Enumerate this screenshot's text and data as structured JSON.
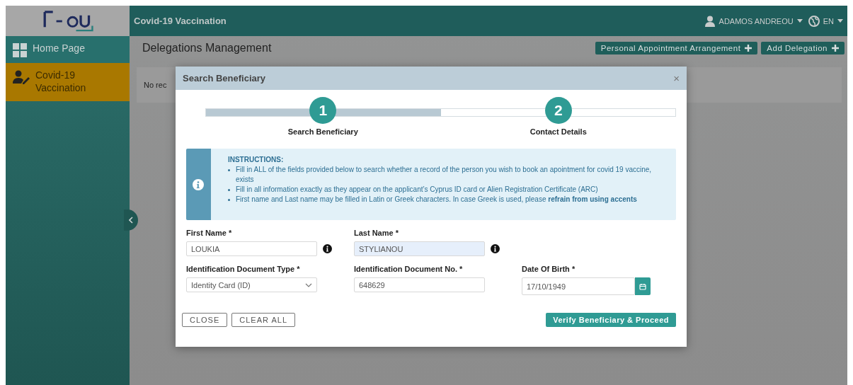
{
  "header": {
    "title": "Covid-19 Vaccination",
    "user": "ADAMOS ANDREOU",
    "language": "EN"
  },
  "sidebar": {
    "items": [
      {
        "label": "Home Page",
        "selected": false
      },
      {
        "label": "Covid-19 Vaccination",
        "selected": true
      }
    ]
  },
  "page": {
    "title": "Delegations Management",
    "buttons": [
      "Personal Appointment Arrangement",
      "Add Delegation"
    ],
    "empty_text": "No rec"
  },
  "dialog": {
    "title": "Search Beneficiary",
    "close": "×",
    "progress": {
      "level": 0.5
    },
    "steps": [
      {
        "number": "1",
        "label": "Search Beneficiary"
      },
      {
        "number": "2",
        "label": "Contact Details"
      }
    ],
    "instructions": {
      "title": "INSTRUCTIONS:",
      "items": [
        "Fill in ALL of the fields provided below to search whether a record of the person you wish to book an apointment for covid 19 vaccine, exists",
        "Fill in all information exactly as they appear on the applicant’s Cyprus ID card or Alien Registration Certificate (ARC)",
        "First name and Last name may be filled in Latin or Greek characters. In case Greek is used, please **refrain from using accents**"
      ]
    },
    "rows": [
      [
        {
          "kind": "text",
          "label": "First Name *",
          "value": "LOUKIA",
          "info": true,
          "highlighted": false
        },
        {
          "kind": "text",
          "label": "Last Name *",
          "value": "STYLIANOU",
          "info": true,
          "highlighted": true
        }
      ],
      [
        {
          "kind": "select",
          "label": "Identification Document Type *",
          "value": "Identity Card (ID)",
          "info": false
        },
        {
          "kind": "text",
          "label": "Identification Document No. *",
          "value": "648629",
          "info": false,
          "highlighted": false
        },
        {
          "kind": "date",
          "label": "Date Of Birth *",
          "value": "17/10/1949",
          "info": false
        }
      ]
    ],
    "left_buttons": [
      "CLOSE",
      "CLEAR ALL"
    ],
    "primary_button": "Verify Beneficiary & Proceed"
  }
}
